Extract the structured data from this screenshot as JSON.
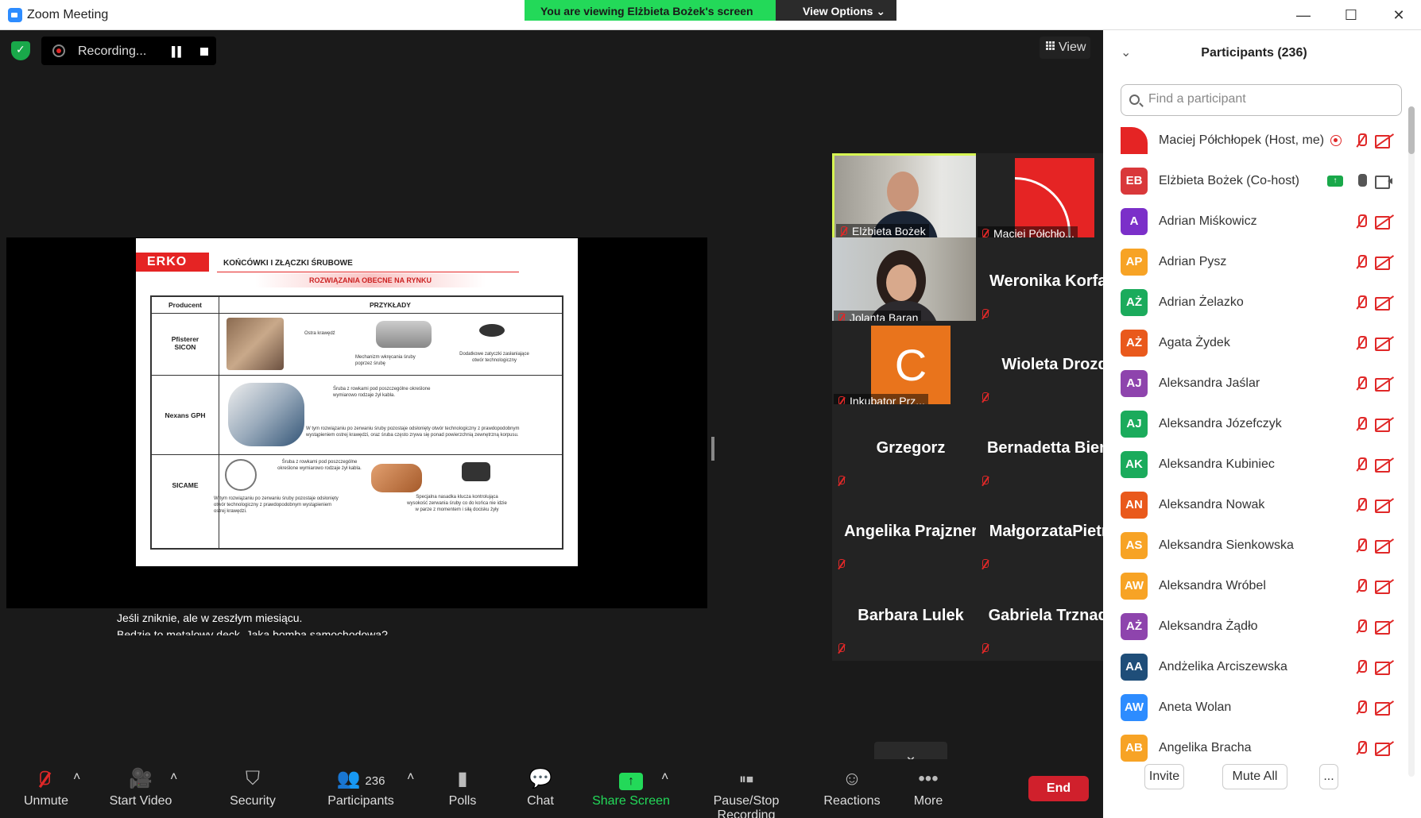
{
  "window": {
    "title": "Zoom Meeting",
    "banner": "You are viewing Elżbieta Bożek's screen",
    "view_options": "View Options ⌄",
    "minimize": "—",
    "maximize": "☐",
    "close": "✕"
  },
  "meeting": {
    "recording_label": "Recording...",
    "view_label": "View",
    "subtitle_line1": "Jeśli zniknie, ale w zeszłym miesiącu.",
    "subtitle_line2": "Będzie to metalowy deck. Jaka bomba samochodowa?"
  },
  "slide": {
    "logo": "ERKO",
    "title": "KOŃCÓWKI I ZŁĄCZKI ŚRUBOWE",
    "subtitle": "ROZWIĄZANIA OBECNE NA RYNKU",
    "col_producent": "Producent",
    "col_przyklady": "PRZYKŁADY",
    "row1": "Pfisterer\nSICON",
    "row2": "Nexans GPH",
    "row3": "SICAME",
    "note1a": "Ostra krawędź",
    "note1b": "Mechanizm wkręcania śruby poprzez śrubę",
    "note1c": "Dodatkowe zatyczki zasłaniające otwór technologiczny",
    "note2a": "Śruba z rowkami pod poszczególne określone wymiarowo rodzaje żył kabla.",
    "note2b": "W tym rozwiązaniu po zerwaniu śruby pozostaje odsłonięty otwór technologiczny z prawdopodobnym wystąpieniem ostrej krawędzi, oraz śruba często zrywa się ponad powierzchnią zewnętrzną korpusu.",
    "note3a": "Śruba z rowkami pod poszczególne określone wymiarowo rodzaje żył kabla.",
    "note3b": "W tym rozwiązaniu po zerwaniu śruby pozostaje odsłonięty otwór technologiczny z prawdopodobnym wystąpieniem ostrej krawędzi.",
    "note3c": "Specjalna nasadka klucza kontrolująca wysokość zerwania śruby co do końca nie idzie w parze z momentem i siłą docisku żyły"
  },
  "tiles": [
    {
      "name": "",
      "label": "Elżbieta Bożek",
      "type": "video1"
    },
    {
      "name": "",
      "label": "Maciej Półchło...",
      "type": "logo"
    },
    {
      "name": "",
      "label": "Jolanta Baran",
      "type": "video2"
    },
    {
      "name": "Weronika  Korfa...",
      "label": "",
      "type": "text"
    },
    {
      "name": "",
      "label": "Inkubator Prz...",
      "type": "letter",
      "letter": "C"
    },
    {
      "name": "Wioleta Drozd",
      "label": "",
      "type": "text"
    },
    {
      "name": "Grzegorz",
      "label": "",
      "type": "text"
    },
    {
      "name": "Bernadetta Bienia",
      "label": "",
      "type": "text"
    },
    {
      "name": "Angelika Prajzner",
      "label": "",
      "type": "text"
    },
    {
      "name": "MałgorzataPietr...",
      "label": "",
      "type": "text"
    },
    {
      "name": "Barbara Lulek",
      "label": "",
      "type": "text"
    },
    {
      "name": "Gabriela Trznadel",
      "label": "",
      "type": "text"
    }
  ],
  "toolbar": {
    "unmute": "Unmute",
    "start_video": "Start Video",
    "security": "Security",
    "participants": "Participants",
    "participants_count": "236",
    "polls": "Polls",
    "chat": "Chat",
    "share_screen": "Share Screen",
    "pause_stop": "Pause/Stop Recording",
    "reactions": "Reactions",
    "more": "More",
    "end": "End"
  },
  "panel": {
    "title": "Participants (236)",
    "search_placeholder": "Find a participant",
    "invite": "Invite",
    "mute_all": "Mute All",
    "more": "...",
    "participants": [
      {
        "initials": "",
        "name": "Maciej Półchłopek (Host, me)",
        "color": "#e52424",
        "logo": true,
        "status": "rec"
      },
      {
        "initials": "EB",
        "name": "Elżbieta Bożek (Co-host)",
        "color": "#d9383a",
        "status": "share"
      },
      {
        "initials": "A",
        "name": "Adrian Miśkowicz",
        "color": "#7b2fc9"
      },
      {
        "initials": "AP",
        "name": "Adrian Pysz",
        "color": "#f7a325"
      },
      {
        "initials": "AŻ",
        "name": "Adrian Żelazko",
        "color": "#1bab5c"
      },
      {
        "initials": "AŻ",
        "name": "Agata Żydek",
        "color": "#e9591c"
      },
      {
        "initials": "AJ",
        "name": "Aleksandra Jaślar",
        "color": "#8e44ad"
      },
      {
        "initials": "AJ",
        "name": "Aleksandra Józefczyk",
        "color": "#1bab5c"
      },
      {
        "initials": "AK",
        "name": "Aleksandra Kubiniec",
        "color": "#1bab5c"
      },
      {
        "initials": "AN",
        "name": "Aleksandra Nowak",
        "color": "#e9591c"
      },
      {
        "initials": "AS",
        "name": "Aleksandra Sienkowska",
        "color": "#f7a325"
      },
      {
        "initials": "AW",
        "name": "Aleksandra Wróbel",
        "color": "#f7a325"
      },
      {
        "initials": "AŻ",
        "name": "Aleksandra Żądło",
        "color": "#8e44ad"
      },
      {
        "initials": "AA",
        "name": "Andżelika Arciszewska",
        "color": "#1f4e79"
      },
      {
        "initials": "AW",
        "name": "Aneta Wolan",
        "color": "#2d8cff"
      },
      {
        "initials": "AB",
        "name": "Angelika Bracha",
        "color": "#f7a325"
      }
    ]
  }
}
